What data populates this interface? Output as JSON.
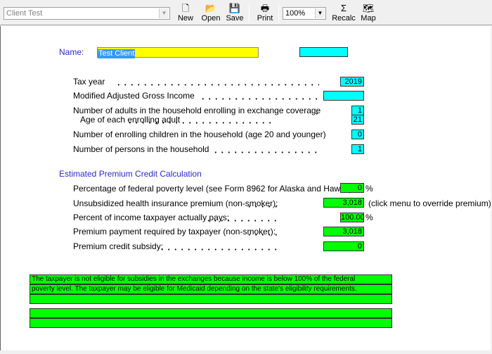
{
  "toolbar": {
    "client_combo": "Client Test",
    "new": "New",
    "open": "Open",
    "save": "Save",
    "print": "Print",
    "zoom": "100%",
    "recalc": "Recalc",
    "map": "Map"
  },
  "form": {
    "name_label": "Name:",
    "name_value": "Test Client",
    "tax_year_label": "Tax year",
    "tax_year": "2019",
    "magi_label": "Modified Adjusted Gross Income",
    "magi": "",
    "adults_label": "Number of adults in the household enrolling in exchange coverage",
    "adults": "1",
    "age_label": "Age of each enrolling adult",
    "age": "21",
    "children_label": "Number of enrolling children in the household (age 20 and younger)",
    "children": "0",
    "persons_label": "Number of persons in the household",
    "persons": "1"
  },
  "calc": {
    "heading": "Estimated Premium Credit Calculation",
    "fpl_label": "Percentage of federal poverty level (see Form 8962 for Alaska and Hawaii)",
    "fpl": "0",
    "pct": "%",
    "premium_label": "Unsubsidized health insurance premium (non-smoker):",
    "premium": "3,018",
    "premium_note": "(click menu to override premium)",
    "pays_label": "Percent of income taxpayer actually pays:",
    "pays": "100.00",
    "required_label": "Premium payment required by taxpayer (non-smoker):",
    "required": "3,018",
    "subsidy_label": "Premium credit subsidy:",
    "subsidy": "0"
  },
  "messages": [
    "The taxpayer is not eligible for subsidies in the exchanges because income is below 100% of the federal",
    "poverty level. The taxpayer may be eligible for Medicaid depending on the state's eligibility requirements.",
    "",
    "",
    ""
  ],
  "colors": {
    "input": "#00ffff",
    "calc": "#00ff00",
    "name": "#ffff00",
    "label_blue": "#2a2ad0"
  }
}
